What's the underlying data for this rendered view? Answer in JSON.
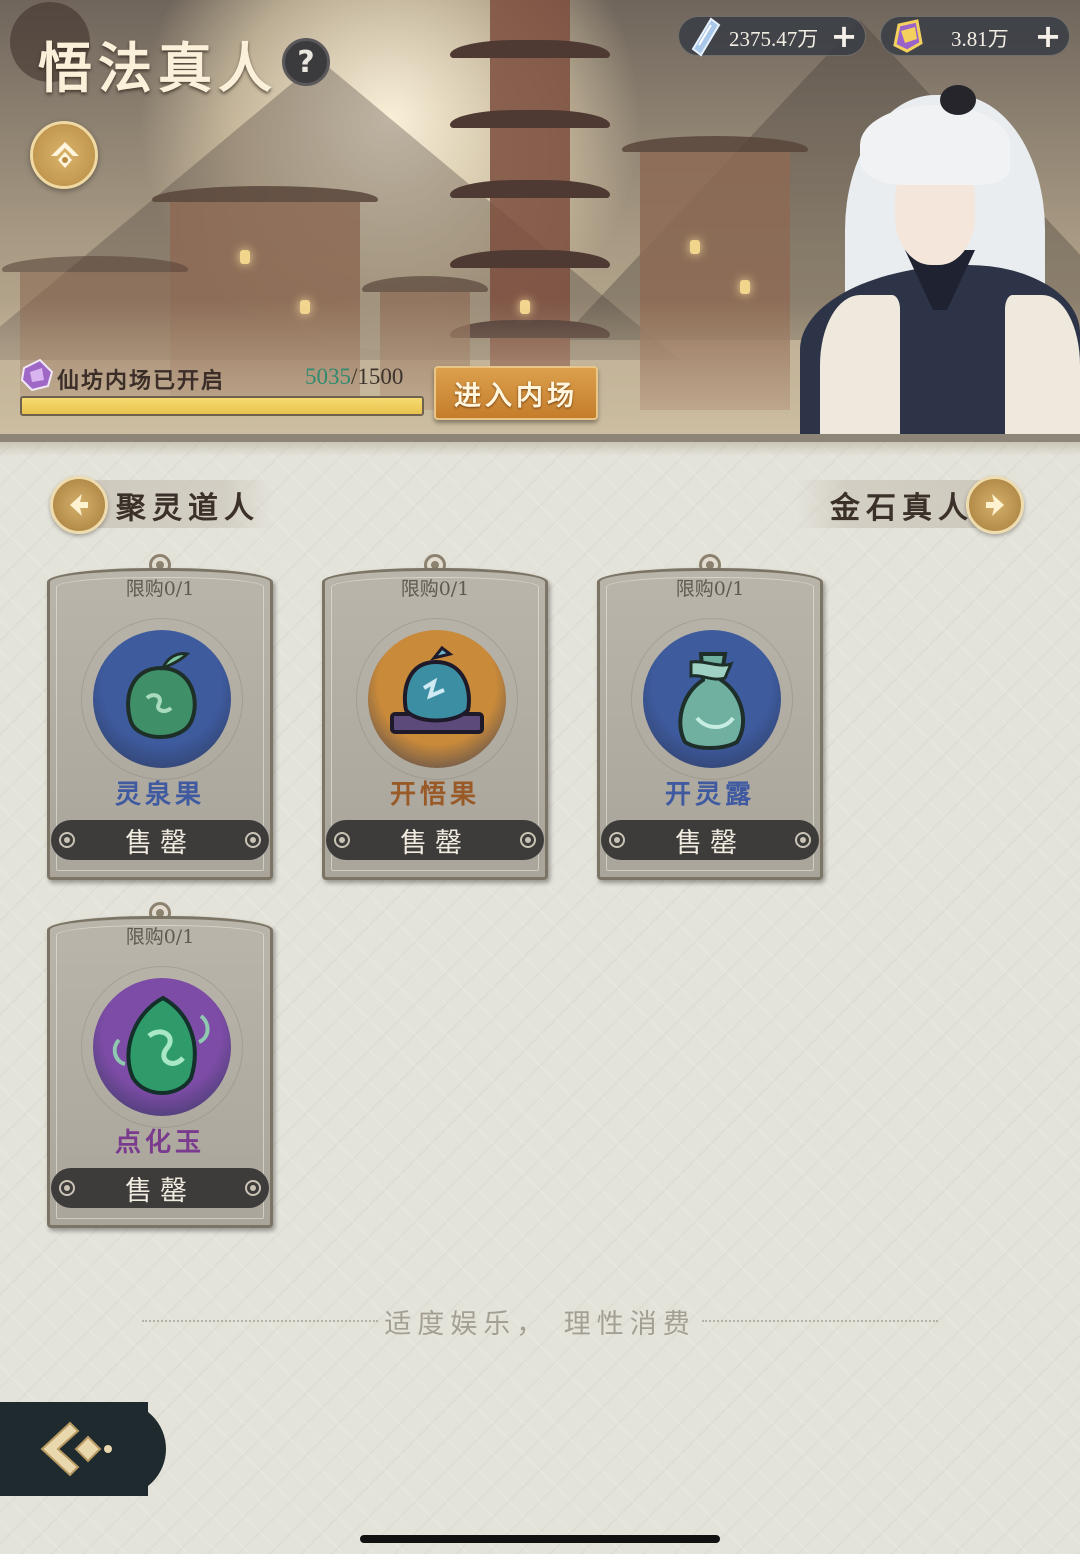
{
  "header": {
    "title": "悟法真人",
    "help_label": "?"
  },
  "currencies": [
    {
      "icon": "crystal-icon",
      "value": "2375.47万",
      "add": "+"
    },
    {
      "icon": "gold-ingot-icon",
      "value": "3.81万",
      "add": "+"
    }
  ],
  "progress": {
    "label": "仙坊内场已开启",
    "current": "5035",
    "separator": "/",
    "max": "1500",
    "fill_fraction": 1.0,
    "enter_label": "进入内场"
  },
  "nav": {
    "prev_npc": "聚灵道人",
    "next_npc": "金石真人"
  },
  "shop_items": [
    {
      "limit": "限购0/1",
      "name": "灵泉果",
      "status": "售罄",
      "name_color": "#3f5aa0",
      "orb_color": "#3e5b9e"
    },
    {
      "limit": "限购0/1",
      "name": "开悟果",
      "status": "售罄",
      "name_color": "#9a5a28",
      "orb_color": "#c98a3a"
    },
    {
      "limit": "限购0/1",
      "name": "开灵露",
      "status": "售罄",
      "name_color": "#3f5aa0",
      "orb_color": "#3e5b9e"
    },
    {
      "limit": "限购0/1",
      "name": "点化玉",
      "status": "售罄",
      "name_color": "#7a3a8e",
      "orb_color": "#7d4ca6"
    }
  ],
  "footer": {
    "slogan": "适度娱乐， 理性消费"
  }
}
